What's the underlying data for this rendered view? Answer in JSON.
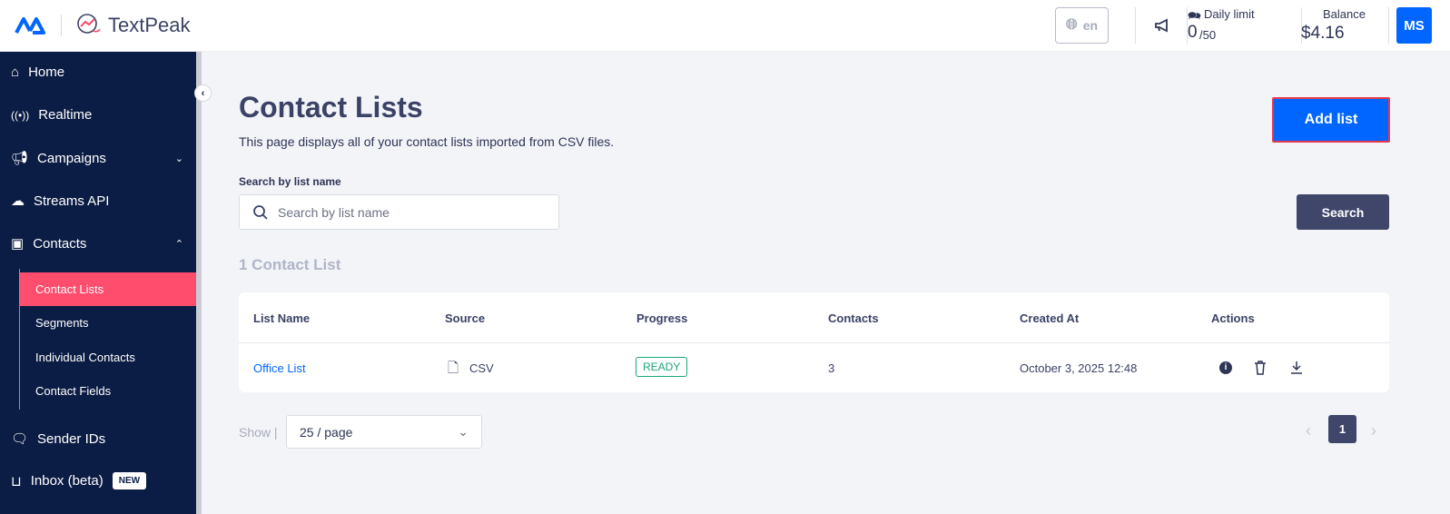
{
  "header": {
    "brand": "TextPeak",
    "language": "en",
    "daily_limit_label": "Daily limit",
    "daily_used": "0",
    "daily_total": "/50",
    "balance_label": "Balance",
    "balance": "$4.16",
    "avatar": "MS"
  },
  "sidebar": {
    "items": [
      {
        "label": "Home"
      },
      {
        "label": "Realtime"
      },
      {
        "label": "Campaigns"
      },
      {
        "label": "Streams API"
      },
      {
        "label": "Contacts"
      },
      {
        "label": "Sender IDs"
      },
      {
        "label": "Inbox (beta)",
        "badge": "NEW"
      }
    ],
    "contacts_sub": [
      "Contact Lists",
      "Segments",
      "Individual Contacts",
      "Contact Fields"
    ]
  },
  "main": {
    "title": "Contact Lists",
    "subtitle": "This page displays all of your contact lists imported from CSV files.",
    "add_list": "Add list",
    "search_label": "Search by list name",
    "search_placeholder": "Search by list name",
    "search_button": "Search",
    "count": "1 Contact List",
    "columns": [
      "List Name",
      "Source",
      "Progress",
      "Contacts",
      "Created At",
      "Actions"
    ],
    "rows": [
      {
        "name": "Office List",
        "source": "CSV",
        "progress": "READY",
        "contacts": "3",
        "created": "October 3, 2025 12:48"
      }
    ],
    "show_label": "Show |",
    "page_size": "25 / page",
    "current_page": "1"
  },
  "colors": {
    "accent": "#0066ff",
    "active": "#ff4d6d",
    "sidebar": "#0c1d45"
  }
}
